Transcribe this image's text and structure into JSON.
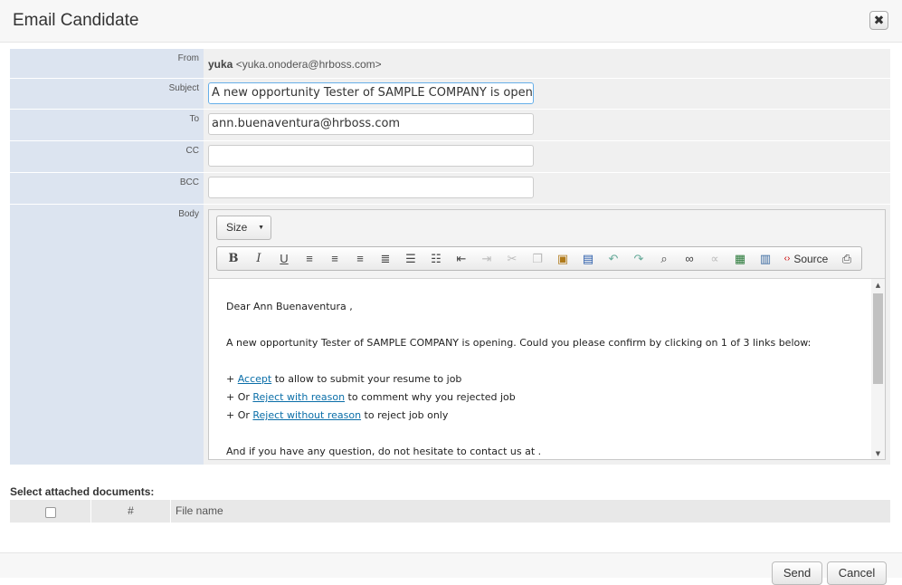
{
  "modal": {
    "title": "Email Candidate",
    "close_label": "✖"
  },
  "form": {
    "from": {
      "label": "From",
      "name": "yuka",
      "email": "<yuka.onodera@hrboss.com>"
    },
    "subject": {
      "label": "Subject",
      "value": "A new opportunity Tester of SAMPLE COMPANY is opening"
    },
    "to": {
      "label": "To",
      "value": "ann.buenaventura@hrboss.com"
    },
    "cc": {
      "label": "CC",
      "value": ""
    },
    "bcc": {
      "label": "BCC",
      "value": ""
    },
    "body": {
      "label": "Body"
    }
  },
  "editor": {
    "size_label": "Size",
    "source_label": "Source",
    "toolbar_icons": [
      "bold-icon",
      "italic-icon",
      "underline-icon",
      "align-left-icon",
      "align-center-icon",
      "align-right-icon",
      "justify-icon",
      "bullet-list-icon",
      "numbered-list-icon",
      "outdent-icon",
      "indent-icon",
      "cut-icon",
      "copy-icon",
      "paste-icon",
      "paste-word-icon",
      "undo-icon",
      "redo-icon",
      "find-icon",
      "link-icon",
      "unlink-icon",
      "image-icon",
      "table-icon",
      "source-icon",
      "print-icon"
    ],
    "content": {
      "greeting": "Dear Ann Buenaventura ,",
      "intro": "A new opportunity Tester of SAMPLE COMPANY is opening. Could you please confirm by clicking on 1 of 3 links below:",
      "line1_prefix": "+ ",
      "line1_link": "Accept",
      "line1_suffix": " to allow to submit your resume to job",
      "line2_prefix": "+ Or ",
      "line2_link": "Reject with reason",
      "line2_suffix": " to comment why you rejected job",
      "line3_prefix": "+ Or ",
      "line3_link": "Reject without reason",
      "line3_suffix": " to reject job only",
      "closing": "And if you have any question, do not hesitate to contact us at ."
    }
  },
  "attachments": {
    "title": "Select attached documents:",
    "columns": {
      "number": "#",
      "file_name": "File name"
    }
  },
  "footer": {
    "send_label": "Send",
    "cancel_label": "Cancel"
  }
}
